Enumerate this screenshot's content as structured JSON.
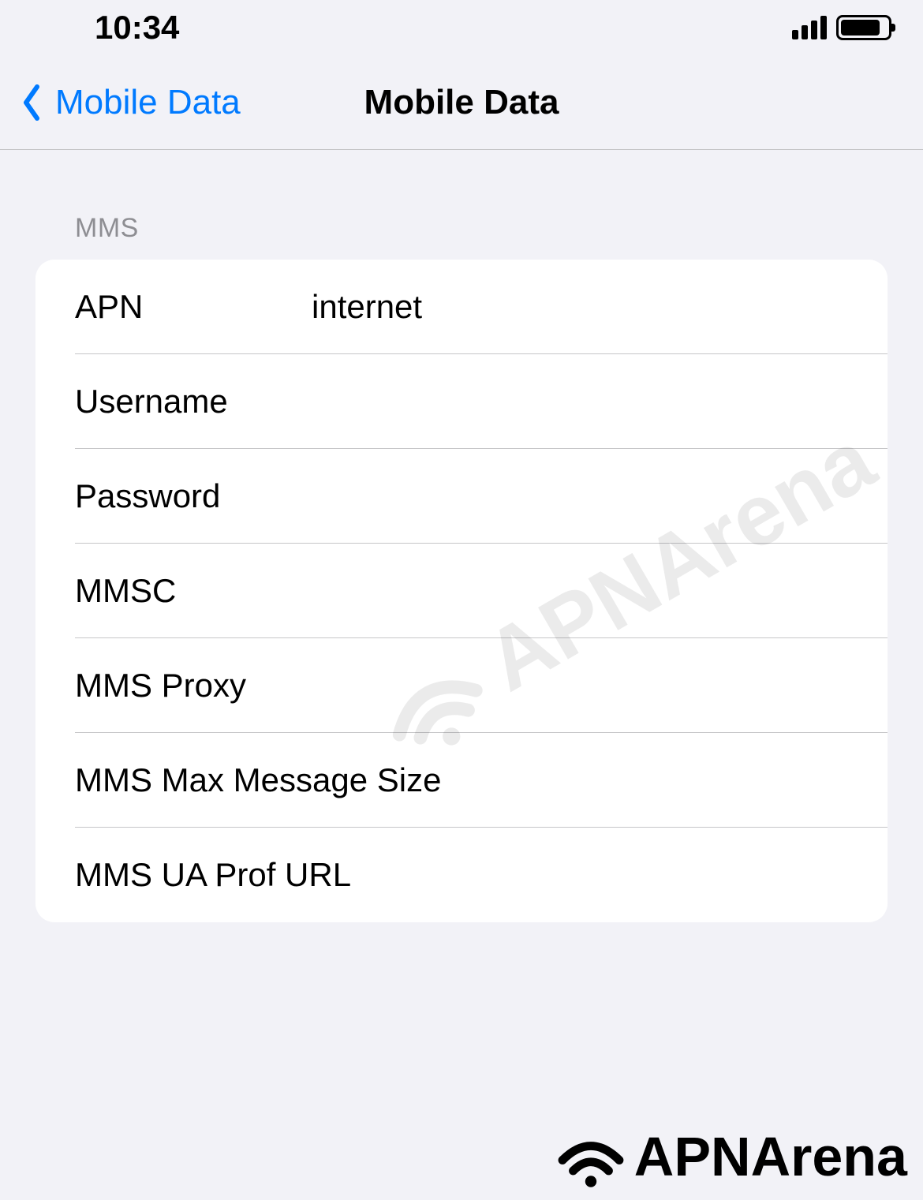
{
  "statusBar": {
    "time": "10:34"
  },
  "navBar": {
    "backLabel": "Mobile Data",
    "title": "Mobile Data"
  },
  "section": {
    "header": "MMS",
    "rows": {
      "apn": {
        "label": "APN",
        "value": "internet"
      },
      "username": {
        "label": "Username",
        "value": ""
      },
      "password": {
        "label": "Password",
        "value": ""
      },
      "mmsc": {
        "label": "MMSC",
        "value": ""
      },
      "mmsProxy": {
        "label": "MMS Proxy",
        "value": ""
      },
      "mmsMaxSize": {
        "label": "MMS Max Message Size",
        "value": ""
      },
      "mmsUaProfUrl": {
        "label": "MMS UA Prof URL",
        "value": ""
      }
    }
  },
  "watermark": "APNArena",
  "footerLogo": "APNArena"
}
